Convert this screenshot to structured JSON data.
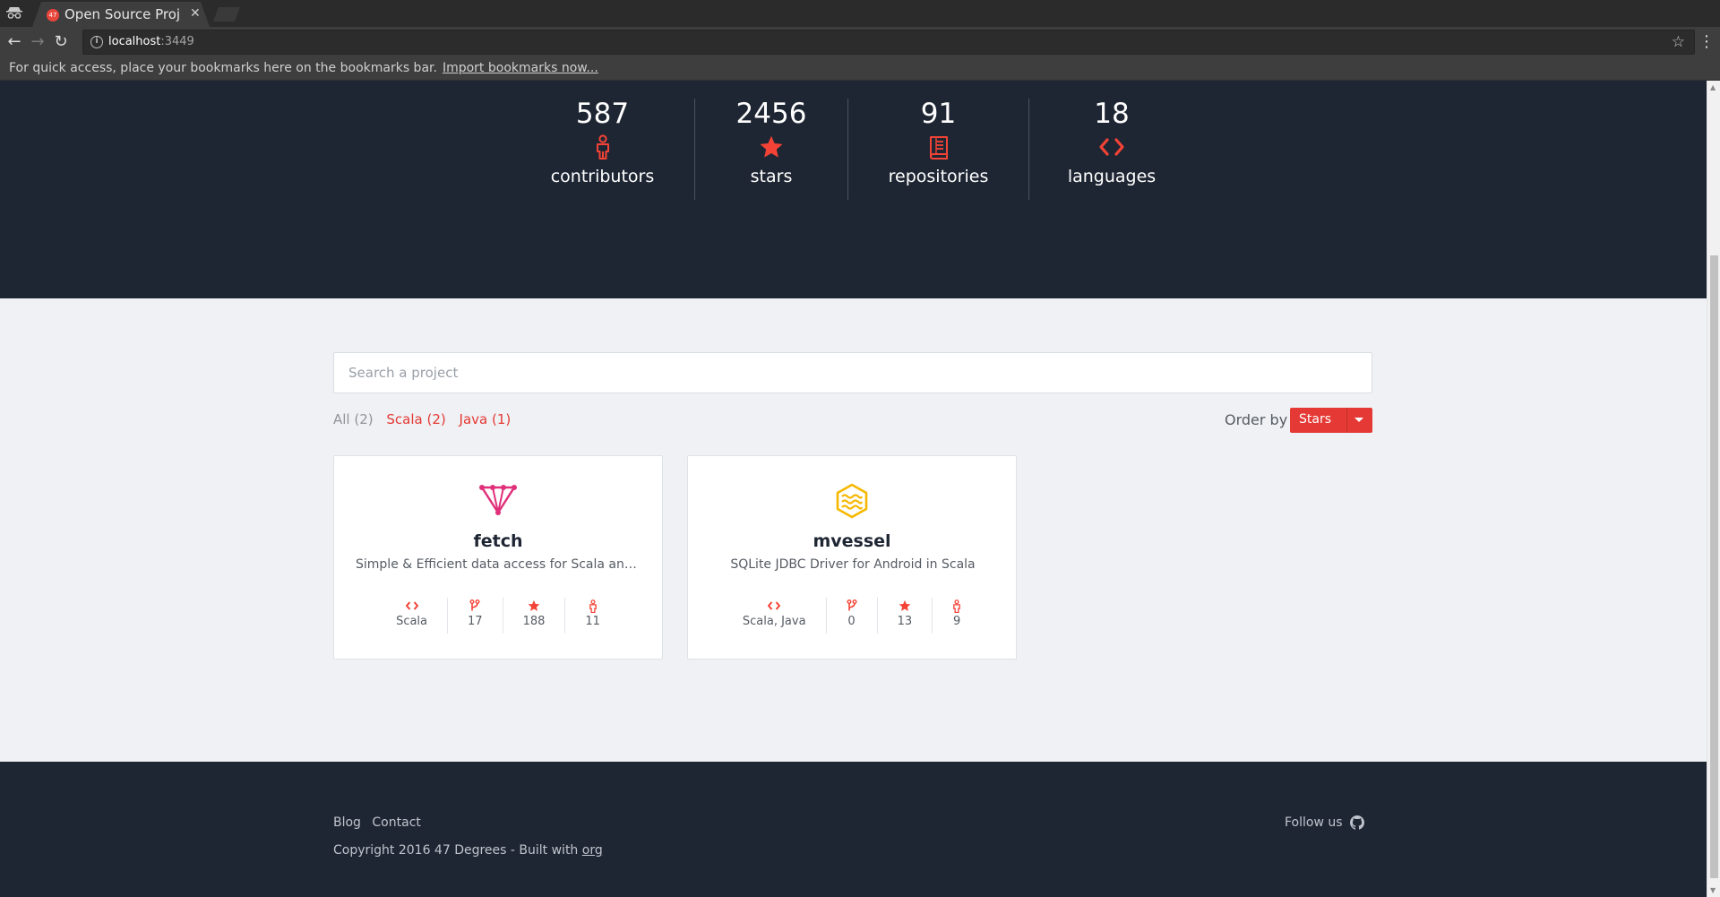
{
  "browser": {
    "tab_title": "Open Source Projec",
    "tab_close": "✕",
    "url_host": "localhost",
    "url_port": ":3449",
    "bookmarks_message": "For quick access, place your bookmarks here on the bookmarks bar.",
    "bookmarks_link": "Import bookmarks now..."
  },
  "stats": [
    {
      "value": "587",
      "label": "contributors",
      "icon": "contributor-icon"
    },
    {
      "value": "2456",
      "label": "stars",
      "icon": "star-icon"
    },
    {
      "value": "91",
      "label": "repositories",
      "icon": "book-icon"
    },
    {
      "value": "18",
      "label": "languages",
      "icon": "code-icon"
    }
  ],
  "search": {
    "placeholder": "Search a project"
  },
  "filters": [
    {
      "label": "All (2)",
      "active": false
    },
    {
      "label": "Scala (2)",
      "active": true
    },
    {
      "label": "Java (1)",
      "active": true
    }
  ],
  "order": {
    "label": "Order by",
    "selected": "Stars"
  },
  "projects": [
    {
      "name": "fetch",
      "description": "Simple & Efficient data access for Scala and ...",
      "logo": "fetch-logo-icon",
      "language": "Scala",
      "forks": "17",
      "stars": "188",
      "contributors": "11"
    },
    {
      "name": "mvessel",
      "description": "SQLite JDBC Driver for Android in Scala",
      "logo": "mvessel-logo-icon",
      "language": "Scala, Java",
      "forks": "0",
      "stars": "13",
      "contributors": "9"
    }
  ],
  "footer": {
    "links": [
      "Blog",
      "Contact"
    ],
    "copyright": "Copyright 2016 47 Degrees - Built with",
    "built_with": "org",
    "follow": "Follow us"
  },
  "colors": {
    "accent": "#e53935",
    "hero_bg": "#1f2633",
    "page_bg": "#eff1f4",
    "fetch_logo": "#e0307a",
    "mvessel_logo": "#f5b800"
  }
}
